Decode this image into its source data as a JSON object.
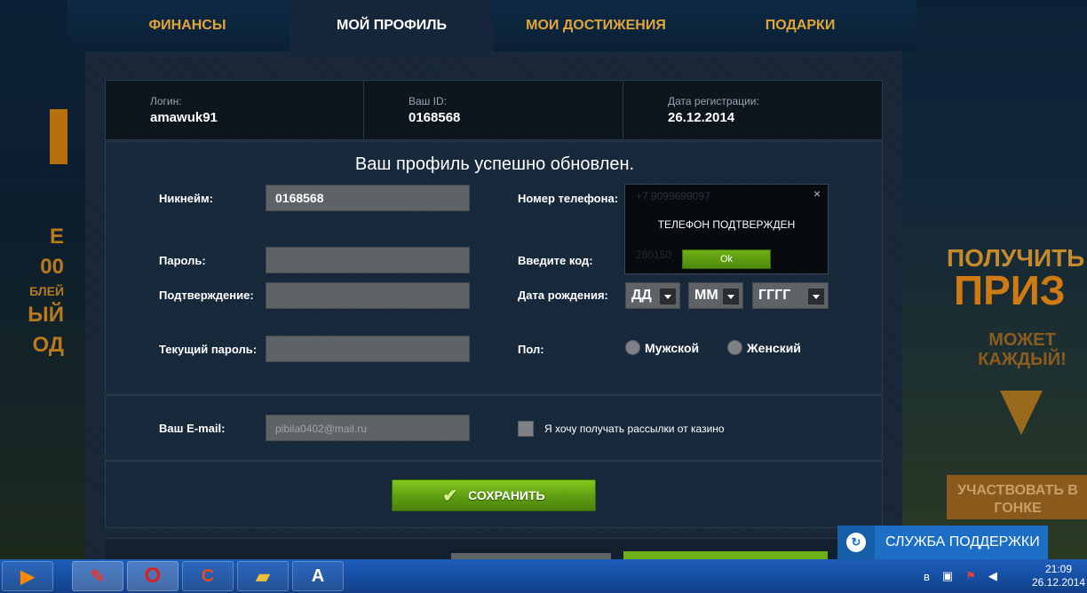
{
  "nav": {
    "tabs": [
      {
        "label": "ФИНАНСЫ"
      },
      {
        "label": "МОЙ ПРОФИЛЬ"
      },
      {
        "label": "МОИ ДОСТИЖЕНИЯ"
      },
      {
        "label": "ПОДАРКИ"
      }
    ],
    "active_tab": "МОЙ ПРОФИЛЬ"
  },
  "account": {
    "login_label": "Логин:",
    "login_value": "amawuk91",
    "id_label": "Ваш ID:",
    "id_value": "0168568",
    "reg_label": "Дата регистрации:",
    "reg_value": "26.12.2014"
  },
  "profile": {
    "success_message": "Ваш профиль успешно обновлен.",
    "nickname_label": "Никнейм:",
    "nickname_value": "0168568",
    "password_label": "Пароль:",
    "confirm_label": "Подтверждение:",
    "current_password_label": "Текущий пароль:",
    "phone_label": "Номер телефона:",
    "phone_value": "+7 9099699097",
    "code_label": "Введите код:",
    "code_value": "280150",
    "birth_label": "Дата рождения:",
    "day_value": "ДД",
    "month_value": "ММ",
    "year_value": "ГГГГ",
    "gender_label": "Пол:",
    "gender_male": "Мужской",
    "gender_female": "Женский"
  },
  "email": {
    "label": "Ваш E-mail:",
    "value": "pibila0402@mail.ru",
    "newsletter_label": "Я хочу получать рассылки от казино"
  },
  "actions": {
    "save_label": "СОХРАНИТЬ"
  },
  "popup": {
    "close_symbol": "×",
    "message": "ТЕЛЕФОН ПОДТВЕРЖДЕН",
    "ok_label": "Ok"
  },
  "promo": {
    "left_lines": [
      "Е",
      "00",
      "БЛЕЙ",
      "ЫЙ",
      "ОД"
    ],
    "right_top": "ПОЛУЧИТЬ",
    "right_big": "ПРИЗ",
    "right_sub": "МОЖЕТ КАЖДЫЙ!",
    "right_race": "УЧАСТВОВАТЬ В ГОНКЕ"
  },
  "support": {
    "label": "СЛУЖБА ПОДДЕРЖКИ"
  },
  "taskbar": {
    "clock_time": "21:09",
    "clock_date": "26.12.2014"
  },
  "colors": {
    "accent_tab": "#e2a53a",
    "save_button": "#6db01a",
    "support": "#1c6fc4"
  }
}
